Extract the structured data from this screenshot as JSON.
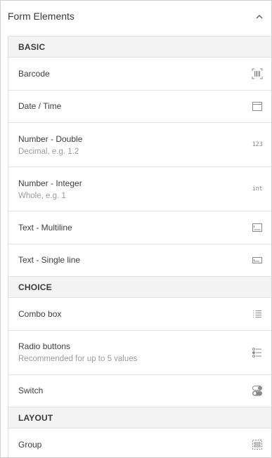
{
  "panel": {
    "title": "Form Elements"
  },
  "sections": {
    "basic": {
      "title": "BASIC",
      "items": [
        {
          "label": "Barcode",
          "icon": "barcode-icon"
        },
        {
          "label": "Date / Time",
          "icon": "calendar-icon"
        },
        {
          "label": "Number - Double",
          "sub": "Decimal, e.g. 1.2",
          "icon": "number-double-icon",
          "icon_text": "123"
        },
        {
          "label": "Number - Integer",
          "sub": "Whole, e.g. 1",
          "icon": "number-integer-icon",
          "icon_text": "int"
        },
        {
          "label": "Text - Multiline",
          "icon": "text-multiline-icon"
        },
        {
          "label": "Text - Single line",
          "icon": "text-single-line-icon"
        }
      ]
    },
    "choice": {
      "title": "CHOICE",
      "items": [
        {
          "label": "Combo box",
          "icon": "list-icon"
        },
        {
          "label": "Radio buttons",
          "sub": "Recommended for up to 5 values",
          "icon": "radio-list-icon"
        },
        {
          "label": "Switch",
          "icon": "switch-icon"
        }
      ]
    },
    "layout": {
      "title": "LAYOUT",
      "items": [
        {
          "label": "Group",
          "icon": "group-icon"
        }
      ]
    }
  },
  "colors": {
    "header_bg": "#f3f3f3",
    "border": "#e0e0e0",
    "text": "#3c3c3c",
    "muted": "#9b9b9b",
    "icon": "#8a8a8a"
  }
}
